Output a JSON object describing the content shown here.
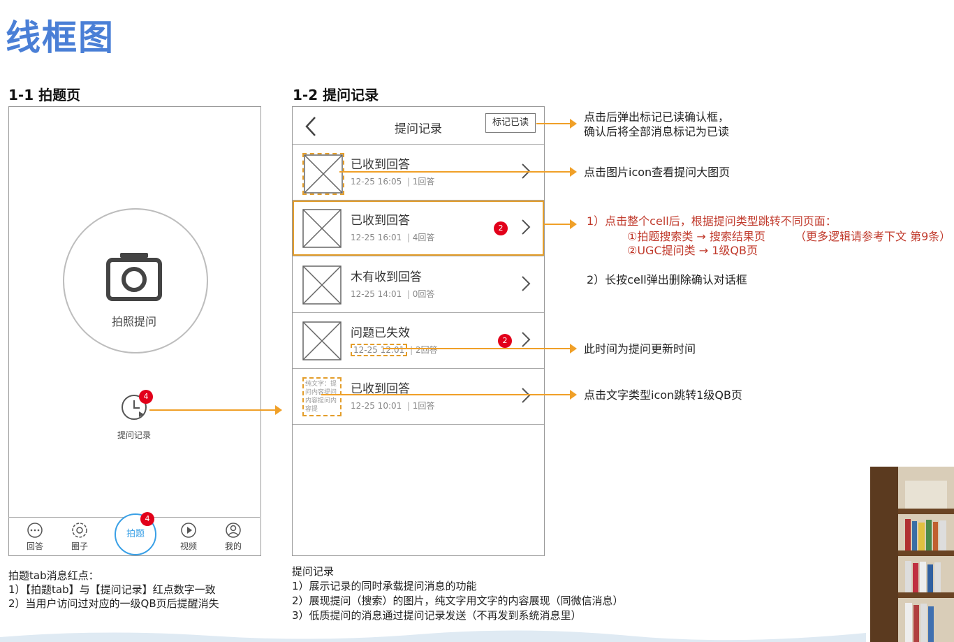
{
  "page": {
    "title": "线框图"
  },
  "left_section": {
    "title": "1-1 拍题页",
    "camera_label": "拍照提问",
    "history_label": "提问记录",
    "history_badge": "4",
    "tabs": [
      {
        "label": "回答",
        "icon": "chat-icon"
      },
      {
        "label": "圈子",
        "icon": "aperture-icon"
      },
      {
        "label": "拍题",
        "icon": "camera-tab",
        "badge": "4"
      },
      {
        "label": "视频",
        "icon": "play-icon"
      },
      {
        "label": "我的",
        "icon": "user-icon"
      }
    ],
    "notes": [
      "拍题tab消息红点：",
      "1）【拍题tab】与【提问记录】红点数字一致",
      "2）当用户访问过对应的一级QB页后提醒消失"
    ]
  },
  "right_section": {
    "title": "1-2 提问记录",
    "nav_title": "提问记录",
    "mark_read": "标记已读",
    "rows": [
      {
        "title": "已收到回答",
        "time": "12-25  16:05",
        "answers": "1回答",
        "badge": ""
      },
      {
        "title": "已收到回答",
        "time": "12-25  16:01",
        "answers": "4回答",
        "badge": "2"
      },
      {
        "title": "木有收到回答",
        "time": "12-25  14:01",
        "answers": "0回答",
        "badge": ""
      },
      {
        "title": "问题已失效",
        "time": "12-25  12:01",
        "answers": "2回答",
        "badge": "2"
      },
      {
        "title": "已收到回答",
        "time": "12-25  10:01",
        "answers": "1回答",
        "badge": "",
        "text_thumb": "纯文字：提问内容提问内容提问内容提"
      }
    ],
    "notes": [
      "提问记录",
      "1）展示记录的同时承载提问消息的功能",
      "2）展现提问（搜索）的图片，纯文字用文字的内容展现（同微信消息）",
      "3）低质提问的消息通过提问记录发送（不再发到系统消息里）"
    ]
  },
  "annotations": {
    "mark_read_1": "点击后弹出标记已读确认框，",
    "mark_read_2": "确认后将全部消息标记为已读",
    "image_icon": "点击图片icon查看提问大图页",
    "cell_1": "1）点击整个cell后，根据提问类型跳转不同页面：",
    "cell_2": "①拍题搜索类 → 搜索结果页",
    "cell_2b": "（更多逻辑请参考下文 第9条）",
    "cell_3": "②UGC提问类 → 1级QB页",
    "long_press": "2）长按cell弹出删除确认对话框",
    "time_note": "此时间为提问更新时间",
    "text_icon": "点击文字类型icon跳转1级QB页"
  },
  "colors": {
    "accent_blue": "#4a7fd6",
    "tab_blue": "#3aa0e6",
    "badge_red": "#e2001a",
    "annotation_orange": "#f0a028",
    "annotation_red": "#c0392b"
  }
}
